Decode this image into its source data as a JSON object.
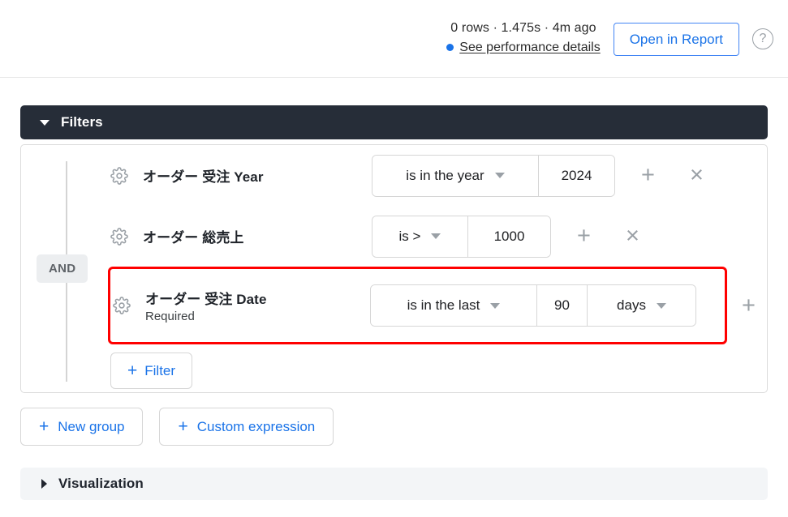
{
  "topbar": {
    "stats": "0 rows · 1.475s · 4m ago",
    "performance_link": "See performance details",
    "status_dot_color": "#1a73e8",
    "open_report_label": "Open in Report",
    "help_icon": "question-mark-circle-icon"
  },
  "filters_section": {
    "title": "Filters",
    "expanded": true,
    "group_operator": "AND",
    "rows": [
      {
        "field_name": "オーダー 受注 Year",
        "field_sub": "",
        "operator": "is in the year",
        "value": "2024",
        "unit": "",
        "has_unit": false,
        "add_label": "+",
        "remove_label": "×",
        "has_remove": true,
        "highlighted": false
      },
      {
        "field_name": "オーダー 総売上",
        "field_sub": "",
        "operator": "is >",
        "value": "1000",
        "unit": "",
        "has_unit": false,
        "add_label": "+",
        "remove_label": "×",
        "has_remove": true,
        "highlighted": false
      },
      {
        "field_name": "オーダー 受注 Date",
        "field_sub": "Required",
        "operator": "is in the last",
        "value": "90",
        "unit": "days",
        "has_unit": true,
        "add_label": "+",
        "remove_label": "",
        "has_remove": false,
        "highlighted": true,
        "highlight_color": "#ff0000"
      }
    ],
    "add_filter_label": "Filter",
    "add_filter_plus": "+"
  },
  "bottom_buttons": [
    {
      "plus": "+",
      "label": "New group"
    },
    {
      "plus": "+",
      "label": "Custom expression"
    }
  ],
  "visualization_section": {
    "title": "Visualization",
    "expanded": false
  },
  "colors": {
    "accent_blue": "#1a73e8",
    "header_dark": "#262d38",
    "highlight_red": "#ff0000",
    "viz_bar_bg": "#f3f5f7"
  }
}
